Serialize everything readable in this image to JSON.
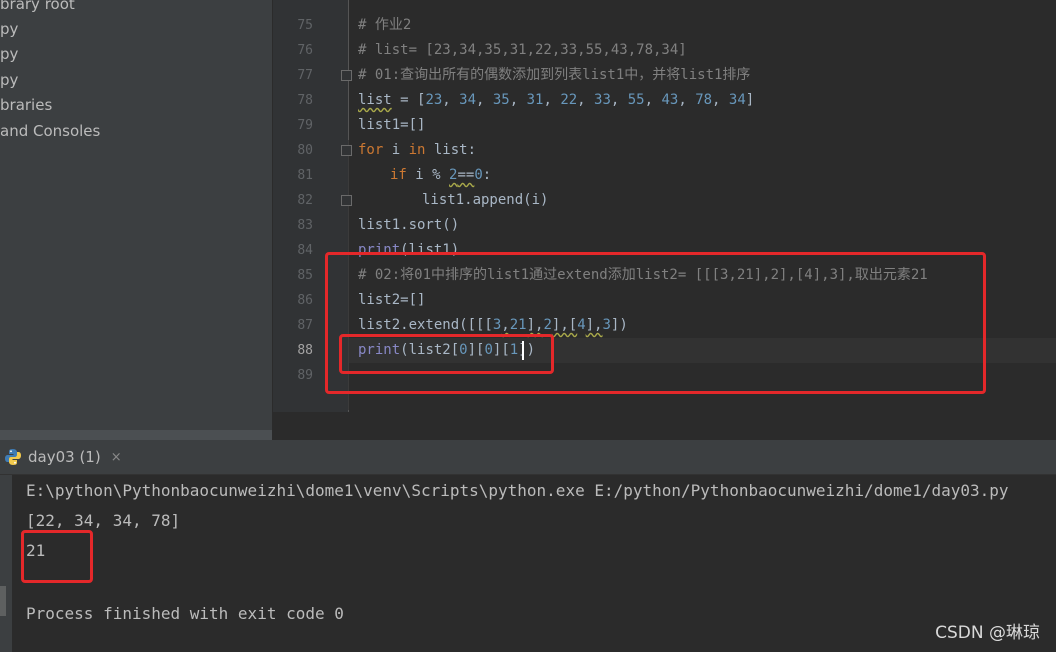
{
  "sidebar": {
    "items": [
      "brary root",
      "py",
      "py",
      "py",
      "braries",
      "and Consoles"
    ]
  },
  "editor": {
    "line_numbers": [
      "75",
      "76",
      "77",
      "78",
      "79",
      "80",
      "81",
      "82",
      "83",
      "84",
      "85",
      "86",
      "87",
      "88",
      "89"
    ],
    "lines": {
      "l75": "# 作业2",
      "l76": "# list= [23,34,35,31,22,33,55,43,78,34]",
      "l77": "# 01:查询出所有的偶数添加到列表list1中，并将list1排序",
      "l78_a": "list",
      "l78_b": " = [",
      "l78_nums": [
        "23",
        "34",
        "35",
        "31",
        "22",
        "33",
        "55",
        "43",
        "78",
        "34"
      ],
      "l78_sep": ", ",
      "l78_end": "]",
      "l79": "list1=[]",
      "l80_kw": "for",
      "l80_a": " i ",
      "l80_in": "in",
      "l80_b": " list:",
      "l81_kw": "if",
      "l81_a": " i % ",
      "l81_num": "2",
      "l81_b": "==",
      "l81_num2": "0",
      "l81_c": ":",
      "l82": "list1.append(i)",
      "l83": "list1.sort()",
      "l84_fn": "print",
      "l84_a": "(list1)",
      "l85": "# 02:将01中排序的list1通过extend添加list2= [[[3,21],2],[4],3],取出元素21",
      "l86": "list2=[]",
      "l87_a": "list2.extend([[[",
      "l87_n1": "3",
      "l87_c1": ",",
      "l87_n2": "21",
      "l87_b": "],",
      "l87_n3": "2",
      "l87_c": "],[",
      "l87_n4": "4",
      "l87_d": "],",
      "l87_n5": "3",
      "l87_e": "])",
      "l88_fn": "print",
      "l88_a": "(list2[",
      "l88_n1": "0",
      "l88_b": "][",
      "l88_n2": "0",
      "l88_c": "][",
      "l88_n3": "1",
      "l88_d": "])"
    }
  },
  "run": {
    "tab_label": "day03 (1)",
    "close_glyph": "×",
    "command": "E:\\python\\Pythonbaocunweizhi\\dome1\\venv\\Scripts\\python.exe E:/python/Pythonbaocunweizhi/dome1/day03.py",
    "output_1": "[22, 34, 34, 78]",
    "output_2": "21",
    "exit_message": "Process finished with exit code 0"
  },
  "watermark": "CSDN @琳琼",
  "colors": {
    "annotation_red": "#e4282a",
    "comment": "#808080",
    "keyword": "#cc7832",
    "number": "#6897bb",
    "builtin": "#8888c6"
  }
}
